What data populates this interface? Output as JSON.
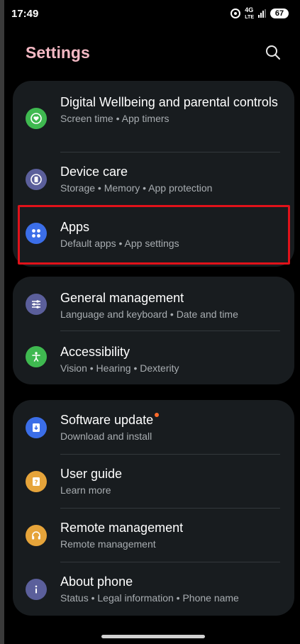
{
  "status_bar": {
    "time": "17:49",
    "network_label_top": "4G",
    "network_label_bottom": "LTE",
    "battery": "67"
  },
  "header": {
    "title": "Settings",
    "search_icon": "search-icon"
  },
  "groups": [
    {
      "items": [
        {
          "title": "Digital Wellbeing and parental controls",
          "subtitle": "Screen time  •  App timers",
          "icon": "wellbeing-heart-icon",
          "color": "#3fb950"
        },
        {
          "title": "Device care",
          "subtitle": "Storage  •  Memory  •  App protection",
          "icon": "device-care-icon",
          "color": "#5b5f9b"
        },
        {
          "title": "Apps",
          "subtitle": "Default apps  •  App settings",
          "icon": "apps-grid-icon",
          "color": "#3b6ee8"
        }
      ]
    },
    {
      "items": [
        {
          "title": "General management",
          "subtitle": "Language and keyboard  •  Date and time",
          "icon": "sliders-icon",
          "color": "#5b5f9b"
        },
        {
          "title": "Accessibility",
          "subtitle": "Vision  •  Hearing  •  Dexterity",
          "icon": "accessibility-person-icon",
          "color": "#3fb950"
        }
      ]
    },
    {
      "items": [
        {
          "title": "Software update",
          "subtitle": "Download and install",
          "icon": "software-update-icon",
          "color": "#3b6ee8",
          "badge_color": "#ff6a2a"
        },
        {
          "title": "User guide",
          "subtitle": "Learn more",
          "icon": "user-guide-icon",
          "color": "#e6a43a"
        },
        {
          "title": "Remote management",
          "subtitle": "Remote management",
          "icon": "headset-icon",
          "color": "#e6a43a"
        },
        {
          "title": "About phone",
          "subtitle": "Status  •  Legal information  •  Phone name",
          "icon": "info-icon",
          "color": "#5b5f9b"
        }
      ]
    }
  ],
  "colors": {
    "background": "#000000",
    "card": "#181c1f",
    "title_accent": "#f4b9c4",
    "highlight_border": "#e0121a",
    "subtitle": "#a8adb1"
  }
}
